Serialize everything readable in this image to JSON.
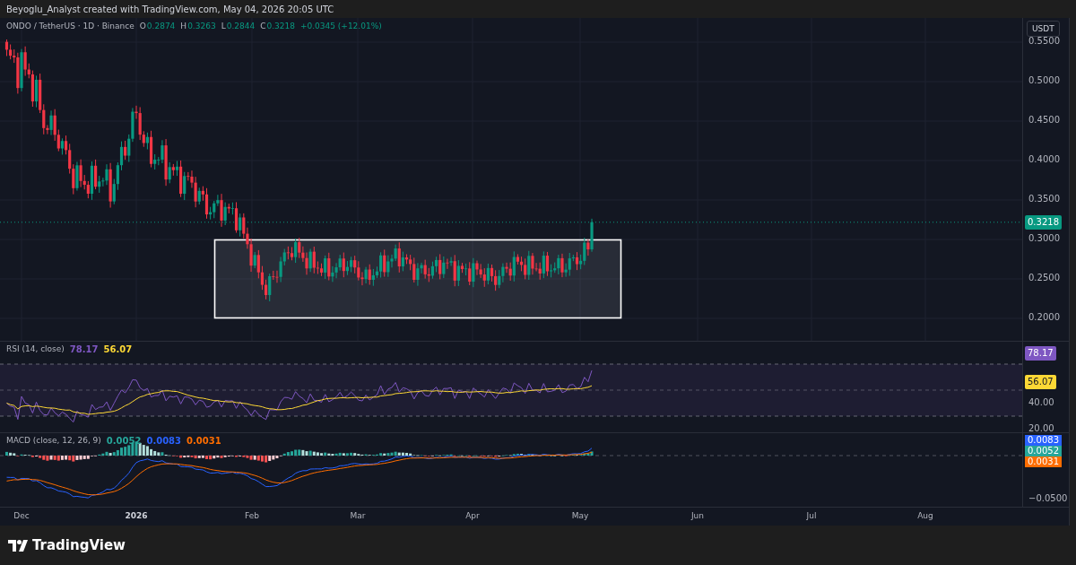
{
  "header": {
    "author_line": "Beyoglu_Analyst created with TradingView.com, May 04, 2026 20:05 UTC"
  },
  "price_pane": {
    "symbol": "ONDO / TetherUS · 1D · Binance",
    "ohlc": [
      {
        "label": "O",
        "value": "0.2874"
      },
      {
        "label": "H",
        "value": "0.3263"
      },
      {
        "label": "L",
        "value": "0.2844"
      },
      {
        "label": "C",
        "value": "0.3218"
      }
    ],
    "change": "+0.0345 (+12.01%)",
    "currency_button": "USDT",
    "axis_ticks": [
      "0.5500",
      "0.5000",
      "0.4500",
      "0.4000",
      "0.3500",
      "0.3000",
      "0.2500",
      "0.2000"
    ],
    "last_price": "0.3218"
  },
  "rsi_pane": {
    "title": "RSI (14, close)",
    "values": [
      {
        "text": "78.17",
        "color": "#7e57c2"
      },
      {
        "text": "56.07",
        "color": "#fdd835"
      }
    ],
    "axis_ticks": [
      "40.00",
      "20.00"
    ],
    "badges": [
      {
        "text": "78.17",
        "color": "#7e57c2"
      },
      {
        "text": "56.07",
        "color": "#fdd835"
      }
    ]
  },
  "macd_pane": {
    "title": "MACD (close, 12, 26, 9)",
    "values": [
      {
        "text": "0.0052",
        "color": "#26a69a"
      },
      {
        "text": "0.0083",
        "color": "#2962ff"
      },
      {
        "text": "0.0031",
        "color": "#ff6d00"
      }
    ],
    "badges": [
      {
        "text": "0.0083",
        "color": "#2962ff"
      },
      {
        "text": "0.0052",
        "color": "#26a69a"
      },
      {
        "text": "0.0031",
        "color": "#ff6d00"
      }
    ],
    "axis_ticks": [
      "−0.0500"
    ]
  },
  "time_axis": [
    "Dec",
    "2026",
    "Feb",
    "Mar",
    "Apr",
    "May",
    "Jun",
    "Jul",
    "Aug"
  ],
  "footer": {
    "logo_text": "TradingView"
  }
}
